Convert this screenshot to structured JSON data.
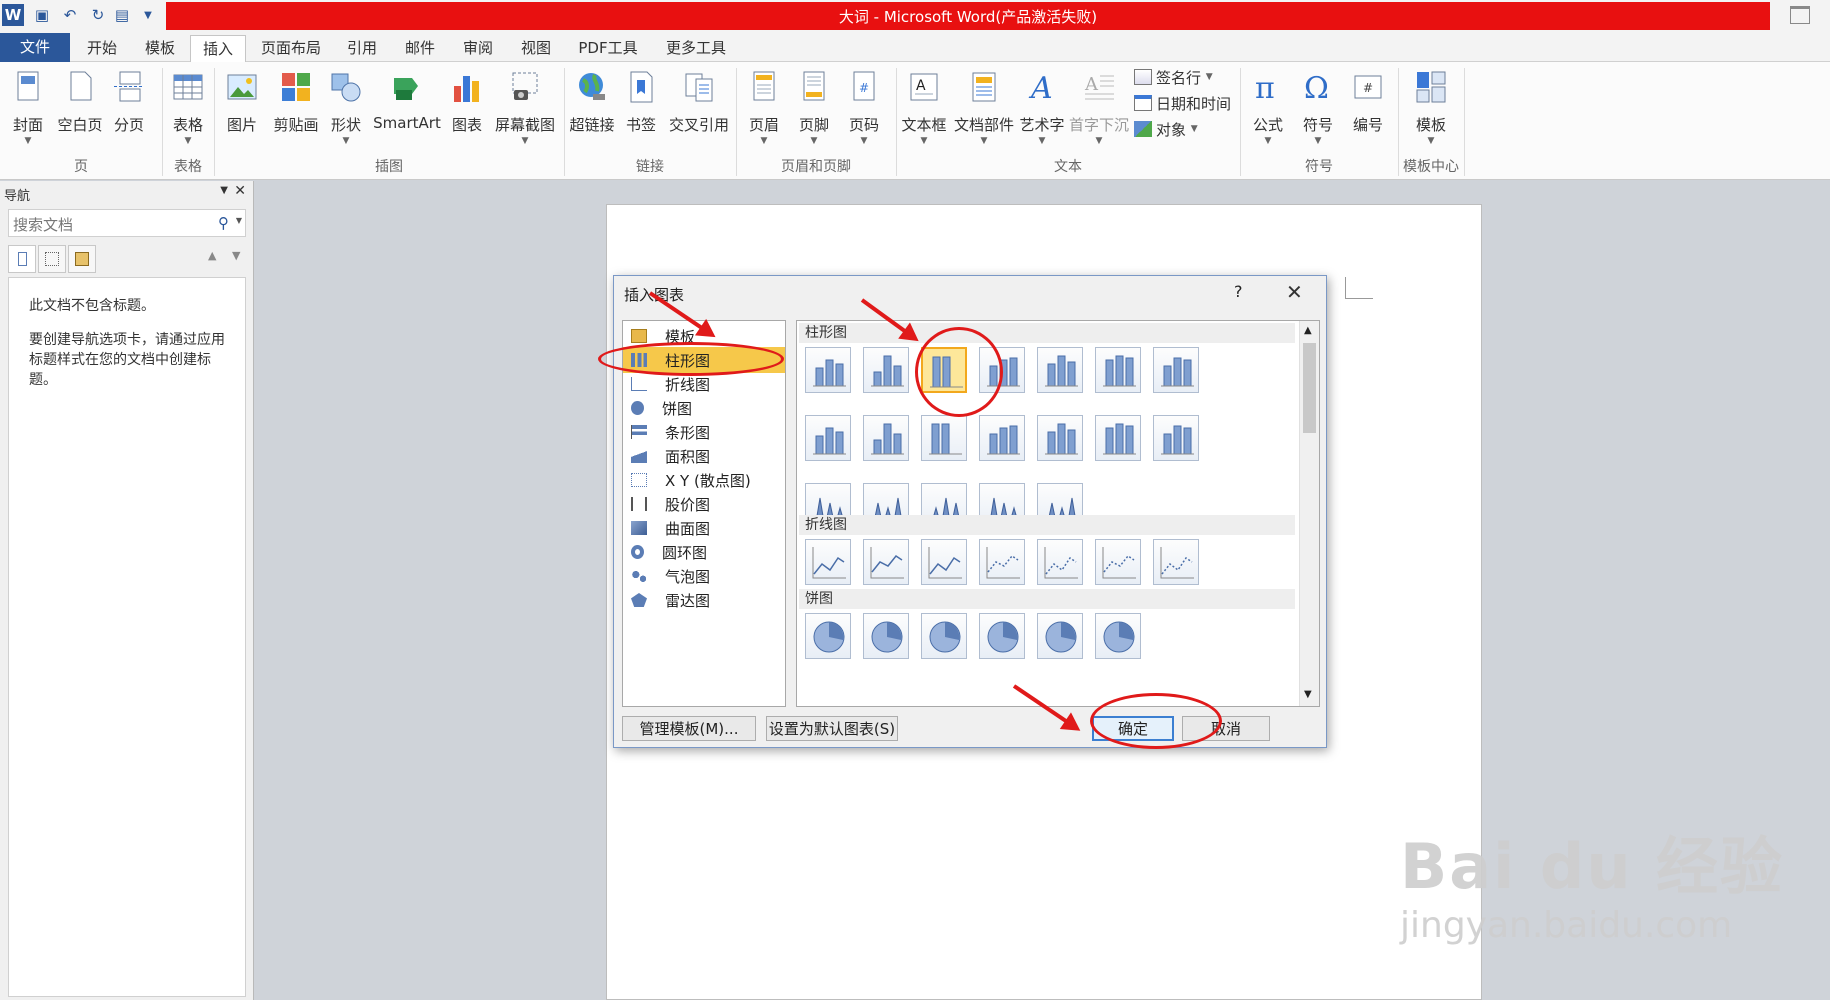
{
  "window": {
    "title": "大词 - Microsoft Word(产品激活失败)"
  },
  "tabs": [
    "文件",
    "开始",
    "模板",
    "插入",
    "页面布局",
    "引用",
    "邮件",
    "审阅",
    "视图",
    "PDF工具",
    "更多工具"
  ],
  "ribbon": {
    "buttons": {
      "cover": "封面",
      "blank_page": "空白页",
      "page_break": "分页",
      "table": "表格",
      "picture": "图片",
      "clipart": "剪贴画",
      "shapes": "形状",
      "smartart": "SmartArt",
      "chart": "图表",
      "screenshot": "屏幕截图",
      "hyperlink": "超链接",
      "bookmark": "书签",
      "cross_ref": "交叉引用",
      "header": "页眉",
      "footer": "页脚",
      "page_number": "页码",
      "textbox": "文本框",
      "quick_parts": "文档部件",
      "wordart": "艺术字",
      "dropcap": "首字下沉",
      "signature": "签名行",
      "datetime": "日期和时间",
      "object": "对象",
      "equation": "公式",
      "symbol": "符号",
      "numbering": "编号",
      "template": "模板"
    },
    "groups": {
      "pages": "页",
      "tables": "表格",
      "illustrations": "插图",
      "links": "链接",
      "header_footer": "页眉和页脚",
      "text": "文本",
      "symbols": "符号",
      "template_center": "模板中心"
    }
  },
  "nav": {
    "title": "导航",
    "search_placeholder": "搜索文档",
    "msg1": "此文档不包含标题。",
    "msg2": "要创建导航选项卡，请通过应用标题样式在您的文档中创建标题。"
  },
  "dialog": {
    "title": "插入图表",
    "help": "?",
    "categories": [
      "模板",
      "柱形图",
      "折线图",
      "饼图",
      "条形图",
      "面积图",
      "X Y (散点图)",
      "股价图",
      "曲面图",
      "圆环图",
      "气泡图",
      "雷达图"
    ],
    "selected_category": "柱形图",
    "sections": [
      "柱形图",
      "折线图",
      "饼图"
    ],
    "buttons": {
      "manage": "管理模板(M)...",
      "set_default": "设置为默认图表(S)",
      "ok": "确定",
      "cancel": "取消"
    }
  },
  "watermark": {
    "brand": "Bai du 经验",
    "url": "jingyan.baidu.com"
  },
  "colors": {
    "title_bar": "#e81010",
    "file_tab": "#2b579a",
    "annotation": "#e01a1a",
    "selection": "#f6c84a"
  }
}
